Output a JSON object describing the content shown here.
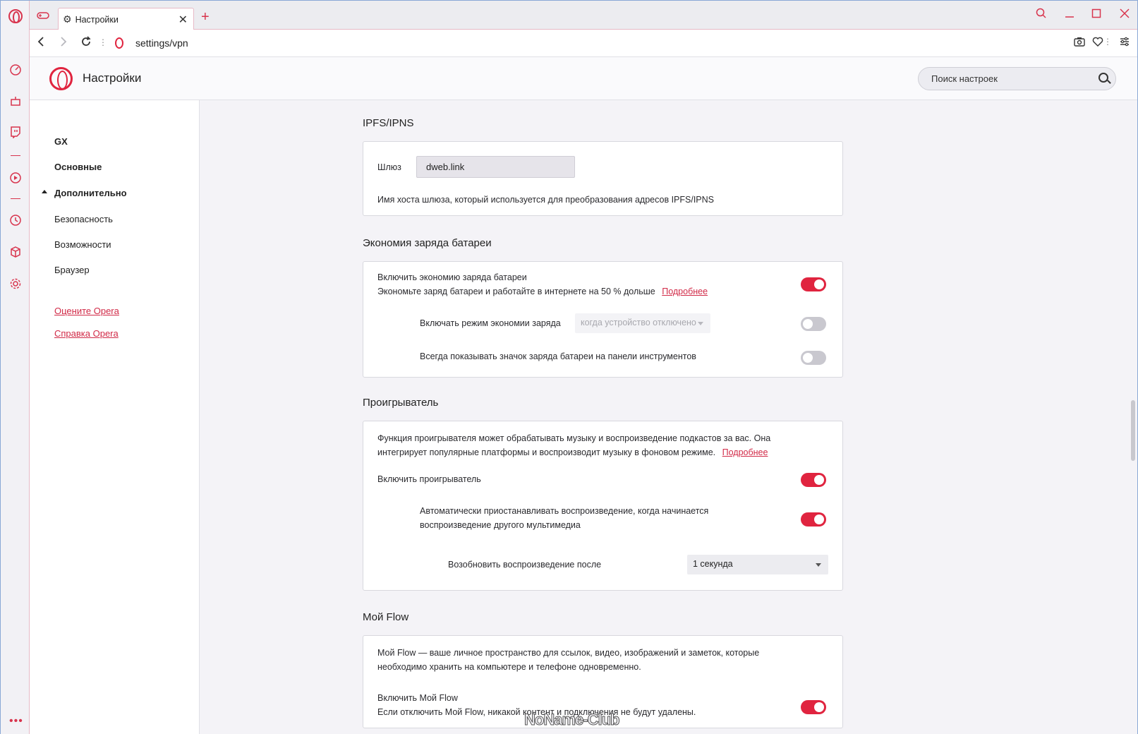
{
  "browser": {
    "tab_title": "Настройки",
    "url": "settings/vpn",
    "new_tab_label": "+"
  },
  "header": {
    "title": "Настройки",
    "search_placeholder": "Поиск настроек"
  },
  "sidebar": {
    "items": [
      {
        "label": "GX"
      },
      {
        "label": "Основные"
      },
      {
        "label": "Дополнительно"
      },
      {
        "label": "Безопасность"
      },
      {
        "label": "Возможности"
      },
      {
        "label": "Браузер"
      }
    ],
    "links": [
      {
        "label": "Оцените Opera"
      },
      {
        "label": "Справка Opera"
      }
    ]
  },
  "ipfs": {
    "title": "IPFS/IPNS",
    "gateway_label": "Шлюз",
    "gateway_value": "dweb.link",
    "gateway_help": "Имя хоста шлюза, который используется для преобразования адресов IPFS/IPNS"
  },
  "battery": {
    "title": "Экономия заряда батареи",
    "enable_label": "Включить экономию заряда батареи",
    "enable_desc": "Экономьте заряд батареи и работайте в интернете на 50 % дольше",
    "more_link": "Подробнее",
    "enable_on": true,
    "mode_label": "Включать режим экономии заряда",
    "mode_select": "когда устройство отключено",
    "mode_on": false,
    "icon_label": "Всегда показывать значок заряда батареи на панели инструментов",
    "icon_on": false
  },
  "player": {
    "title": "Проигрыватель",
    "desc_line1": "Функция проигрывателя может обрабатывать музыку и воспроизведение подкастов за вас. Она",
    "desc_line2": "интегрирует популярные платформы и воспроизводит музыку в фоновом режиме.",
    "more_link": "Подробнее",
    "enable_label": "Включить проигрыватель",
    "enable_on": true,
    "autopause_line1": "Автоматически приостанавливать воспроизведение, когда начинается",
    "autopause_line2": "воспроизведение другого мультимедиа",
    "autopause_on": true,
    "resume_label": "Возобновить воспроизведение после",
    "resume_select": "1 секунда"
  },
  "flow": {
    "title": "Мой Flow",
    "desc_line1": "Мой Flow — ваше личное пространство для ссылок, видео, изображений и заметок, которые",
    "desc_line2": "необходимо хранить на компьютере и телефоне одновременно.",
    "enable_label": "Включить Мой Flow",
    "enable_desc": "Если отключить Мой Flow, никакой контент и подключения не будут удалены.",
    "enable_on": true
  },
  "watermark": "NoName-Club",
  "colors": {
    "accent": "#e0243f",
    "link": "#d12a47",
    "toggle_off": "#c9c8cf"
  }
}
